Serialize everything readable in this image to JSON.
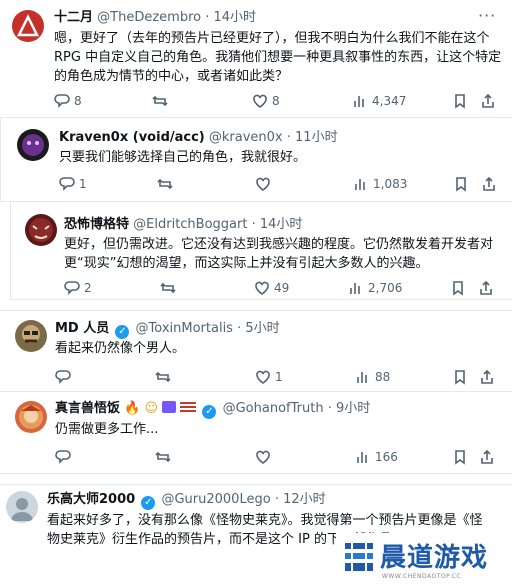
{
  "tweets": [
    {
      "name": "十二月",
      "handle": "@TheDezembro",
      "time": "· 14小时",
      "lines": [
        "嗯，更好了（去年的预告片已经更好了），但我不明白为什么我们不能在这个",
        "RPG 中自定义自己的角色。我猜他们想要一种更具叙事性的东西，让这个特定",
        "的角色成为情节的中心，或者诸如此类？"
      ],
      "replies": "8",
      "retweets": "",
      "likes": "8",
      "views": "4,347"
    },
    {
      "name": "Kraven0x (void/acc)",
      "handle": "@kraven0x",
      "time": "· 11小时",
      "lines": [
        "只要我们能够选择自己的角色，我就很好。"
      ],
      "replies": "1",
      "retweets": "",
      "likes": "",
      "views": "1,083"
    },
    {
      "name": "恐怖博格特",
      "handle": "@EldritchBoggart",
      "time": "· 14小时",
      "lines": [
        "更好，但仍需改进。它还没有达到我感兴趣的程度。它仍然散发着开发者对",
        "更“现实”幻想的渴望，而这实际上并没有引起大多数人的兴趣。"
      ],
      "replies": "2",
      "retweets": "",
      "likes": "49",
      "views": "2,706"
    },
    {
      "name": "MD 人员",
      "handle": "@ToxinMortalis",
      "time": "· 5小时",
      "lines": [
        "看起来仍然像个男人。"
      ],
      "replies": "",
      "retweets": "",
      "likes": "1",
      "views": "88"
    },
    {
      "name": "真言兽悟饭",
      "handle": "@GohanofTruth",
      "time": "· 9小时",
      "lines": [
        "仍需做更多工作..."
      ],
      "replies": "",
      "retweets": "",
      "likes": "",
      "views": "166"
    },
    {
      "name": "乐高大师2000",
      "handle": "@Guru2000Lego",
      "time": "· 12小时",
      "lines": [
        "看起来好多了，没有那么像《怪物史莱克》。我觉得第一个预告片更像是《怪",
        "物史莱克》衍生作品的预告片，而不是这个 IP 的下一部作品"
      ],
      "replies": "",
      "retweets": "",
      "likes": "",
      "views": ""
    }
  ],
  "watermark": {
    "title": "晨道游戏",
    "subtitle": "WWW.CHENDAOTOP.CC"
  },
  "colors": {
    "accent": "#1d9bf0",
    "muted": "#536471",
    "text": "#0f1419"
  },
  "icons": [
    "reply-icon",
    "retweet-icon",
    "like-icon",
    "views-icon",
    "bookmark-icon",
    "share-icon",
    "more-icon",
    "verified-icon"
  ]
}
